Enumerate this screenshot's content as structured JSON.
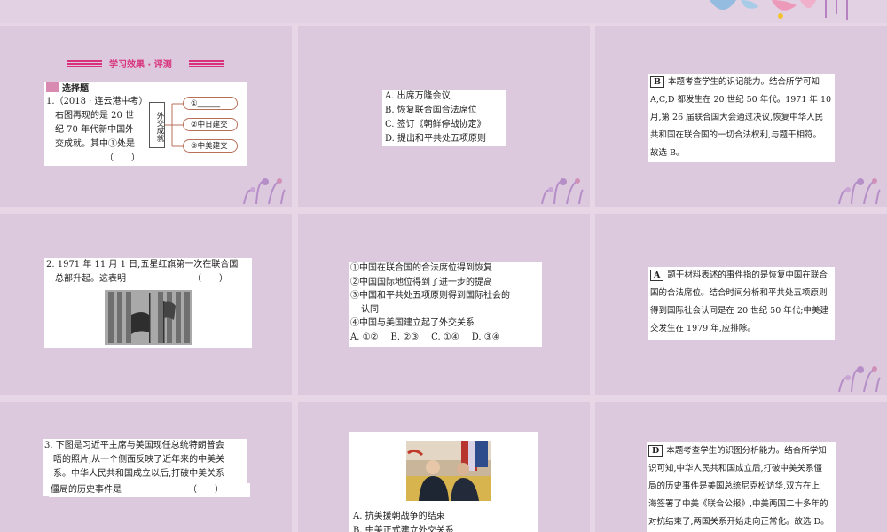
{
  "section_header": "学习效果 · 评测",
  "section_tag": "选择题",
  "q1": {
    "stem": [
      "1.（2018 · 连云港中考）",
      "右图再现的是 20 世",
      "纪 70 年代新中国外",
      "交成就。其中①处是",
      "（　　）"
    ],
    "diagram_label": "外交成就",
    "items": [
      "①______",
      "②中日建交",
      "③中美建交"
    ],
    "options": [
      "A. 出席万隆会议",
      "B. 恢复联合国合法席位",
      "C. 签订《朝鲜停战协定》",
      "D. 提出和平共处五项原则"
    ],
    "answer": "B",
    "explanation": [
      "本题考查学生的识记能力。结合所学可知",
      "A,C,D 都发生在 20 世纪 50 年代。1971 年 10",
      "月,第 26 届联合国大会通过决议,恢复中华人民",
      "共和国在联合国的一切合法权利,与题干相符。",
      "故选 B。"
    ]
  },
  "q2": {
    "stem": [
      "2. 1971 年 11 月 1 日,五星红旗第一次在联合国",
      "总部升起。这表明　　　　　　　　（　　）"
    ],
    "statements": [
      "①中国在联合国的合法席位得到恢复",
      "②中国国际地位得到了进一步的提高",
      "③中国和平共处五项原则得到国际社会的",
      "认同",
      "④中国与美国建立起了外交关系"
    ],
    "options": [
      "A. ①②",
      "B. ②③",
      "C. ①④",
      "D. ③④"
    ],
    "answer": "A",
    "explanation": [
      "题干材料表述的事件指的是恢复中国在联合",
      "国的合法席位。结合时间分析和平共处五项原则",
      "得到国际社会认同是在 20 世纪 50 年代;中美建",
      "交发生在 1979 年,应排除。"
    ]
  },
  "q3": {
    "stem": [
      "3. 下图是习近平主席与美国现任总统特朗普会",
      "晤的照片,从一个侧面反映了近年来的中美关",
      "系。中华人民共和国成立以后,打破中美关系",
      "僵局的历史事件是　　　　　　　　（　　）"
    ],
    "options": [
      "A. 抗美援朝战争的结束",
      "B. 中美正式建立外交关系"
    ],
    "answer": "D",
    "explanation": [
      "本题考查学生的识图分析能力。结合所学知",
      "识可知,中华人民共和国成立后,打破中美关系僵",
      "局的历史事件是美国总统尼克松访华,双方在上",
      "海签署了中美《联合公报》,中美两国二十多年的",
      "对抗结束了,两国关系开始走向正常化。故选 D。"
    ]
  },
  "colors": {
    "background": "#e6d6e6",
    "panel": "#ddc9dd",
    "accent": "#d8327c"
  }
}
